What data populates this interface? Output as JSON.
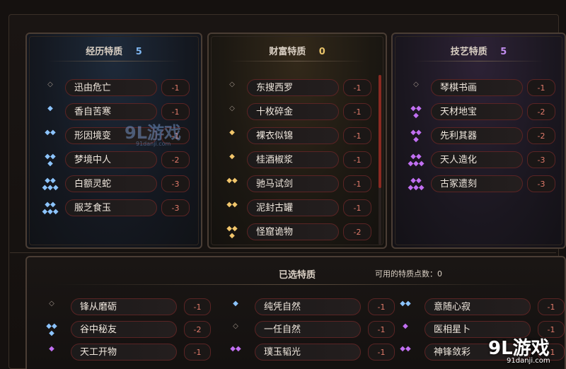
{
  "experience": {
    "title": "经历特质",
    "count": "5",
    "traits": [
      {
        "name": "迅由危亡",
        "cost": "-1",
        "icon": "◇",
        "tone": "hollow"
      },
      {
        "name": "香自苦寒",
        "cost": "-1",
        "icon": "◆",
        "tone": "blue"
      },
      {
        "name": "形因境变",
        "cost": "-1",
        "icon": "◆◆",
        "tone": "blue"
      },
      {
        "name": "梦境中人",
        "cost": "-2",
        "icon": "◆◆\n◆",
        "tone": "blue"
      },
      {
        "name": "白额灵蛇",
        "cost": "-3",
        "icon": "◆◆\n◆◆◆",
        "tone": "blue"
      },
      {
        "name": "服芝食玉",
        "cost": "-3",
        "icon": "◆◆\n◆◆◆",
        "tone": "blue"
      }
    ]
  },
  "wealth": {
    "title": "财富特质",
    "count": "0",
    "traits": [
      {
        "name": "东搜西罗",
        "cost": "-1",
        "icon": "◇",
        "tone": "hollow"
      },
      {
        "name": "十枚碎金",
        "cost": "-1",
        "icon": "◇",
        "tone": "hollow"
      },
      {
        "name": "裸衣似锦",
        "cost": "-1",
        "icon": "◆",
        "tone": "gold"
      },
      {
        "name": "桂酒椒浆",
        "cost": "-1",
        "icon": "◆",
        "tone": "gold"
      },
      {
        "name": "驰马试剑",
        "cost": "-1",
        "icon": "◆◆",
        "tone": "gold"
      },
      {
        "name": "泥封古罐",
        "cost": "-1",
        "icon": "◆◆",
        "tone": "gold"
      },
      {
        "name": "怪窟诡物",
        "cost": "-2",
        "icon": "◆◆\n◆",
        "tone": "gold"
      }
    ]
  },
  "skill": {
    "title": "技艺特质",
    "count": "5",
    "traits": [
      {
        "name": "琴棋书画",
        "cost": "-1",
        "icon": "◇",
        "tone": "hollow"
      },
      {
        "name": "天材地宝",
        "cost": "-2",
        "icon": "◆◆\n◆",
        "tone": "purple"
      },
      {
        "name": "先利其器",
        "cost": "-2",
        "icon": "◆◆\n◆",
        "tone": "purple"
      },
      {
        "name": "天人造化",
        "cost": "-3",
        "icon": "◆◆\n◆◆◆",
        "tone": "purple"
      },
      {
        "name": "古冢遗刻",
        "cost": "-3",
        "icon": "◆◆\n◆◆◆",
        "tone": "purple"
      }
    ]
  },
  "selected": {
    "title": "已选特质",
    "points_label": "可用的特质点数：",
    "points_value": "0",
    "traits": [
      {
        "name": "锋从磨砺",
        "cost": "-1",
        "icon": "◇",
        "tone": "hollow"
      },
      {
        "name": "纯凭自然",
        "cost": "-1",
        "icon": "◆",
        "tone": "blue"
      },
      {
        "name": "意随心寂",
        "cost": "-1",
        "icon": "◆◆",
        "tone": "blue"
      },
      {
        "name": "谷中秘友",
        "cost": "-2",
        "icon": "◆◆\n◆",
        "tone": "blue"
      },
      {
        "name": "一任自然",
        "cost": "-1",
        "icon": "◇",
        "tone": "hollow"
      },
      {
        "name": "医相星卜",
        "cost": "-1",
        "icon": "◆",
        "tone": "purple"
      },
      {
        "name": "天工开物",
        "cost": "-1",
        "icon": "◆",
        "tone": "purple"
      },
      {
        "name": "璞玉韬光",
        "cost": "-1",
        "icon": "◆◆",
        "tone": "purple"
      },
      {
        "name": "神锋敛彩",
        "cost": "-1",
        "icon": "◆◆",
        "tone": "purple"
      }
    ]
  },
  "watermark": {
    "logo_text": "9L游戏",
    "domain": "91danji.com"
  }
}
